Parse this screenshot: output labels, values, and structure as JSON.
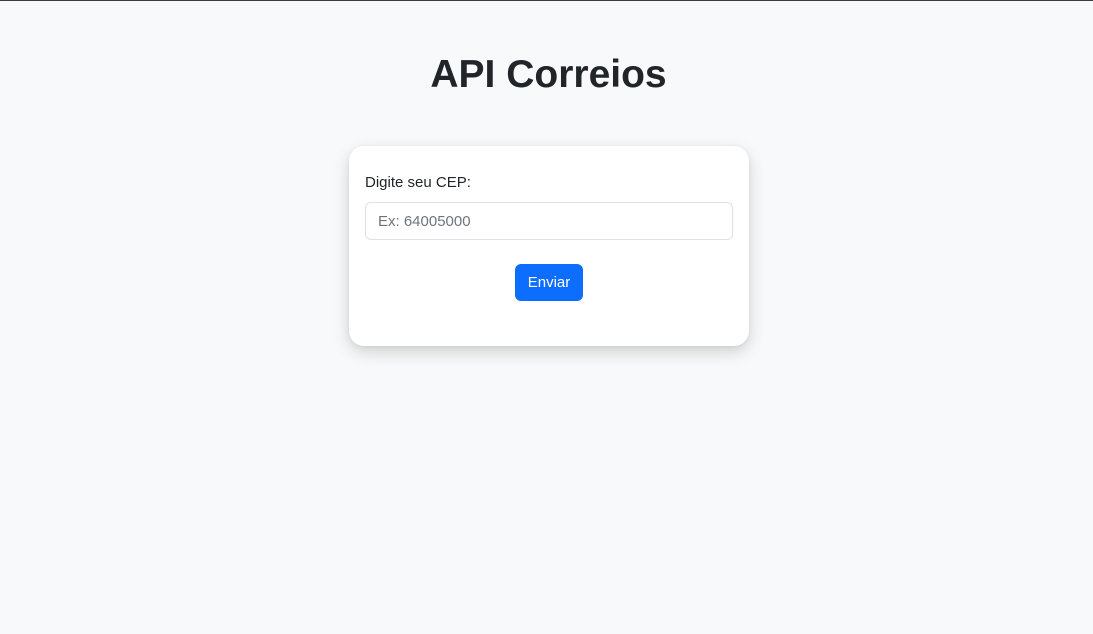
{
  "page": {
    "title": "API Correios"
  },
  "form": {
    "cep_label": "Digite seu CEP:",
    "cep_placeholder": "Ex: 64005000",
    "cep_value": "",
    "submit_label": "Enviar"
  },
  "colors": {
    "background": "#f8f9fa",
    "card": "#ffffff",
    "primary_button": "#0d6efd",
    "text": "#212529"
  }
}
